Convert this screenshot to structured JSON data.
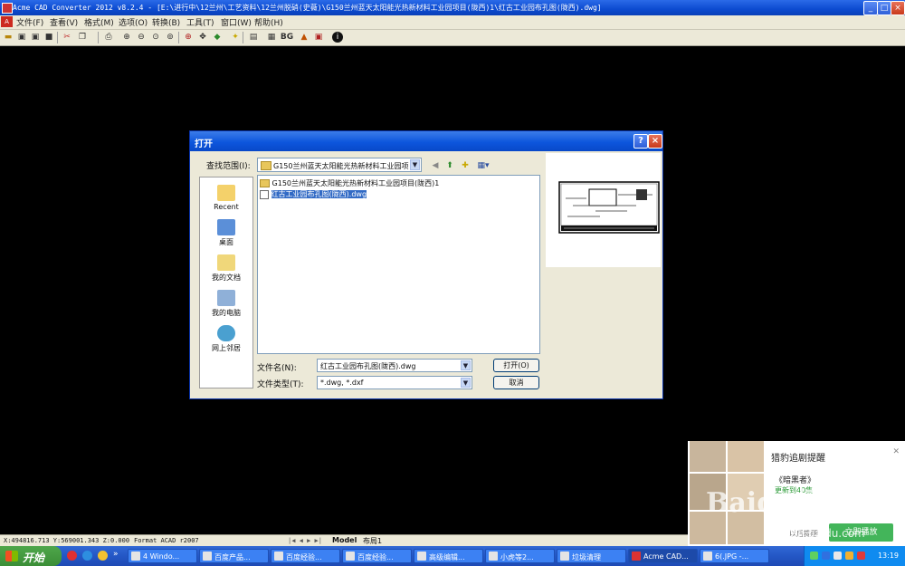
{
  "window": {
    "title": "Acme CAD Converter 2012 v8.2.4 - [E:\\进行中\\12兰州\\工艺资料\\12兰州脱硝(史薇)\\G150兰州蓝天太阳能光热新材料工业园项目(陇西)1\\红古工业园布孔图(陇西).dwg]"
  },
  "menu": [
    "文件(F)",
    "查看(V)",
    "格式(M)",
    "选项(O)",
    "转换(B)",
    "工具(T)",
    "窗口(W)",
    "帮助(H)"
  ],
  "toolbar": {
    "bg_label": "BG"
  },
  "dialog": {
    "title": "打开",
    "lookin_label": "查找范围(I):",
    "lookin_value": "G150兰州蓝天太阳能光热新材料工业园项",
    "places": [
      "Recent",
      "桌面",
      "我的文档",
      "我的电脑",
      "网上邻居"
    ],
    "files": [
      "G150兰州蓝天太阳能光热新材料工业园项目(陇西)1",
      "红古工业园布孔图(陇西).dwg"
    ],
    "filename_label": "文件名(N):",
    "filename_value": "红古工业园布孔图(陇西).dwg",
    "filetype_label": "文件类型(T):",
    "filetype_value": "*.dwg, *.dxf",
    "open_button": "打开(O)",
    "cancel_button": "取消"
  },
  "status": {
    "coords": "X:494816.713 Y:569001.343 Z:0.000",
    "format": "Format ACAD r2007",
    "tab_model": "Model",
    "tab_layout": "布局1"
  },
  "taskbar": {
    "start": "开始",
    "tasks": [
      "4 Windo...",
      "百度产品...",
      "百度经验...",
      "百度经验...",
      "高级编辑...",
      "小虎等2...",
      "垃圾清理",
      "Acme CAD...",
      "6(.JPG -..."
    ],
    "clock": "13:19"
  },
  "popup": {
    "title": "猎豹追剧提醒",
    "show": "《暗黑者》",
    "update": "更新到40集",
    "remind": "以后提醒",
    "play": "立即播放"
  },
  "watermark": {
    "logo": "Baidu经验",
    "url": "jingyan.baidu.com"
  }
}
